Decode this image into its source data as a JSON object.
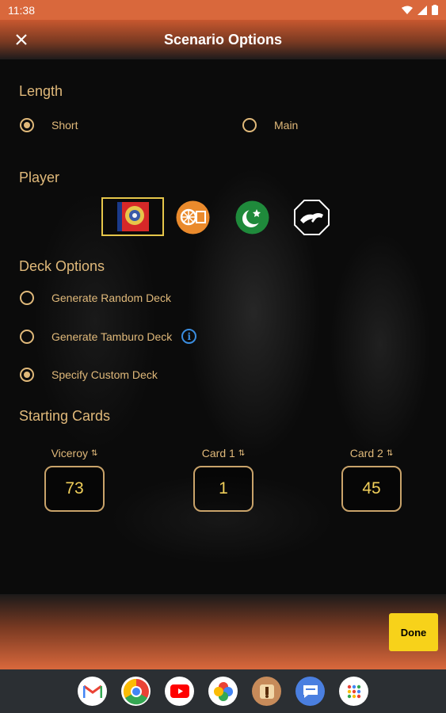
{
  "status_bar": {
    "time": "11:38"
  },
  "header": {
    "title": "Scenario Options"
  },
  "length": {
    "title": "Length",
    "options": [
      {
        "label": "Short",
        "selected": true
      },
      {
        "label": "Main",
        "selected": false
      }
    ]
  },
  "player": {
    "title": "Player",
    "tokens": [
      {
        "name": "british-raj-token",
        "selected": true
      },
      {
        "name": "congress-token",
        "selected": false
      },
      {
        "name": "muslim-league-token",
        "selected": false
      },
      {
        "name": "revolutionary-token",
        "selected": false
      }
    ]
  },
  "deck_options": {
    "title": "Deck Options",
    "options": [
      {
        "label": "Generate Random Deck",
        "selected": false
      },
      {
        "label": "Generate Tamburo Deck",
        "selected": false,
        "has_info": true
      },
      {
        "label": "Specify Custom Deck",
        "selected": true
      }
    ]
  },
  "starting_cards": {
    "title": "Starting Cards",
    "sort_icon": "⇅",
    "cards": [
      {
        "label": "Viceroy",
        "value": "73"
      },
      {
        "label": "Card 1",
        "value": "1"
      },
      {
        "label": "Card 2",
        "value": "45"
      }
    ]
  },
  "done_label": "Done",
  "colors": {
    "accent": "#e0b97a",
    "done": "#f7d21a",
    "value": "#f0cf5a"
  },
  "dock": [
    "gmail-icon",
    "chrome-icon",
    "youtube-icon",
    "photos-icon",
    "app-icon",
    "messages-icon",
    "app-drawer-icon"
  ]
}
